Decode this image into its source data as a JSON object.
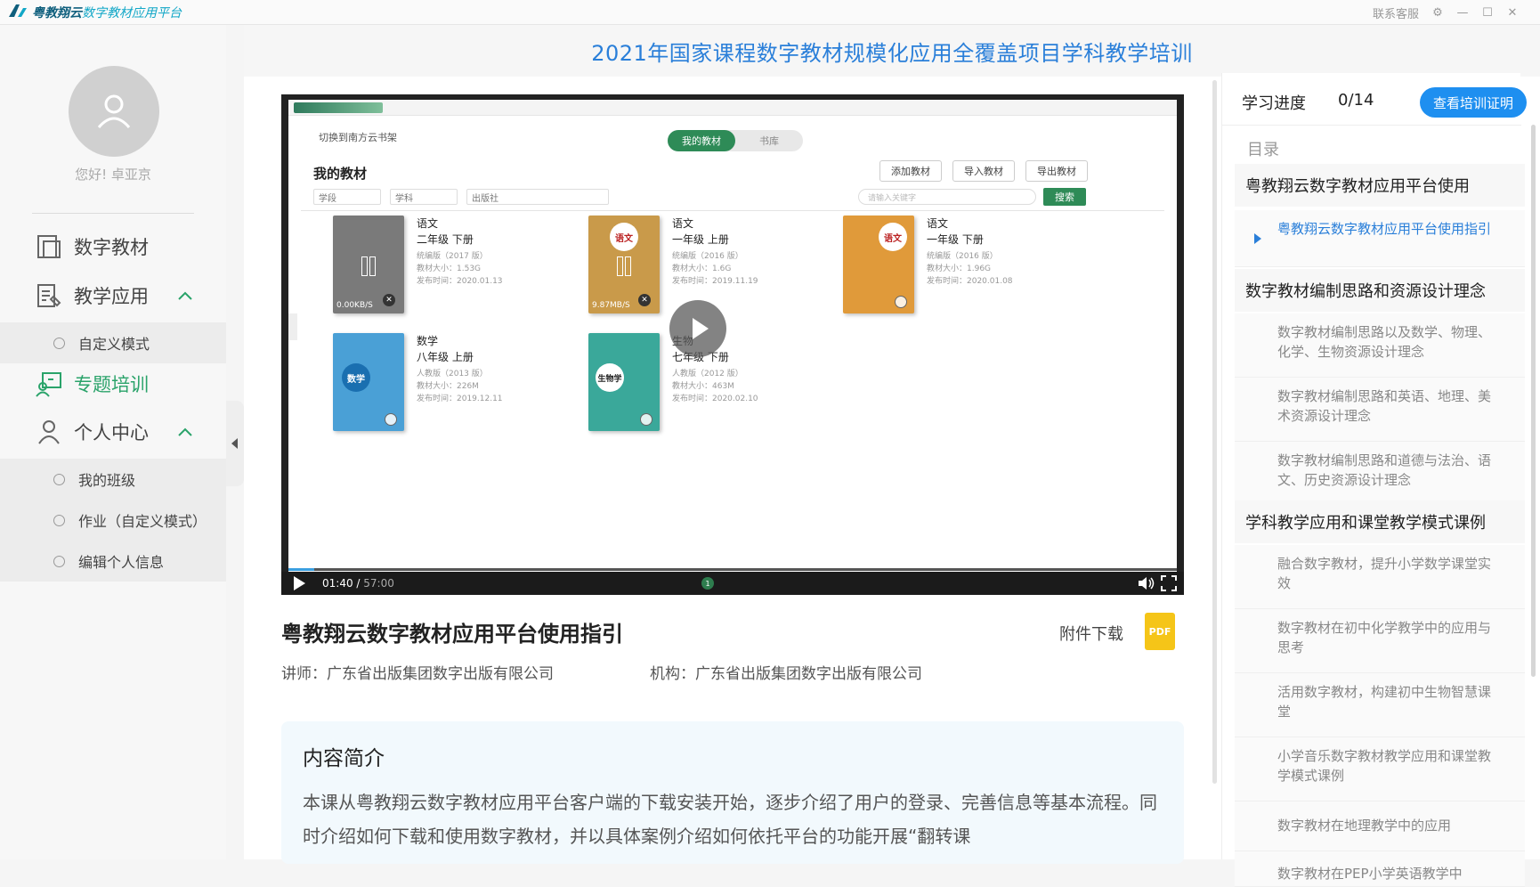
{
  "app": {
    "name_main": "粤教翔云",
    "name_accent": "数字教材应用平台",
    "window_controls": {
      "service": "联系客服"
    }
  },
  "sidebar": {
    "greeting": "您好!  卓亚京",
    "items": [
      {
        "label": "数字教材",
        "icon": "book-icon"
      },
      {
        "label": "教学应用",
        "icon": "teach-app-icon",
        "expanded": true,
        "children": [
          "自定义模式"
        ]
      },
      {
        "label": "专题培训",
        "icon": "training-icon",
        "active": true
      },
      {
        "label": "个人中心",
        "icon": "user-icon",
        "expanded": true,
        "children": [
          "我的班级",
          "作业（自定义模式）",
          "编辑个人信息"
        ]
      }
    ]
  },
  "page": {
    "title": "2021年国家课程数字教材规模化应用全覆盖项目学科教学培训"
  },
  "video": {
    "current_time": "01:40",
    "duration": "57:00",
    "progress": 0.029,
    "marker_label": "1",
    "screen": {
      "switch_label": "切换到南方云书架",
      "tabs": [
        "我的教材",
        "书库"
      ],
      "heading": "我的教材",
      "buttons": [
        "添加教材",
        "导入教材",
        "导出教材"
      ],
      "filters": [
        "学段",
        "学科",
        "出版社"
      ],
      "search_placeholder": "请输入关键字",
      "search_button": "搜索",
      "books": [
        {
          "subject": "语文",
          "grade": "二年级  下册",
          "edition": "统编版（2017 版）",
          "size": "教材大小：1.53G",
          "date": "发布时间：2020.01.13",
          "cover_color": "#7a7a7a",
          "cover_text": "",
          "speed": "0.00KB/S",
          "downloading": true
        },
        {
          "subject": "语文",
          "grade": "一年级  上册",
          "edition": "统编版（2016 版）",
          "size": "教材大小：1.6G",
          "date": "发布时间：2019.11.19",
          "cover_color": "#c99a4a",
          "cover_text": "语文",
          "speed": "9.87MB/S",
          "downloading": true
        },
        {
          "subject": "语文",
          "grade": "一年级  下册",
          "edition": "统编版（2016 版）",
          "size": "教材大小：1.96G",
          "date": "发布时间：2020.01.08",
          "cover_color": "#e09a3a",
          "cover_text": "语文",
          "speed": "",
          "downloading": false
        },
        {
          "subject": "数学",
          "grade": "八年级  上册",
          "edition": "人教版（2013 版）",
          "size": "教材大小：226M",
          "date": "发布时间：2019.12.11",
          "cover_color": "#4aa0d6",
          "cover_text": "数学",
          "speed": "",
          "downloading": false
        },
        {
          "subject": "生物",
          "grade": "七年级  下册",
          "edition": "人教版（2012 版）",
          "size": "教材大小：463M",
          "date": "发布时间：2020.02.10",
          "cover_color": "#3aa89a",
          "cover_text": "生物学",
          "speed": "",
          "downloading": false
        }
      ]
    }
  },
  "course": {
    "title": "粤教翔云数字教材应用平台使用指引",
    "attachment_label": "附件下载",
    "pdf_label": "PDF",
    "lecturer": "讲师：广东省出版集团数字出版有限公司",
    "org": "机构：广东省出版集团数字出版有限公司",
    "intro_title": "内容简介",
    "intro_body": "本课从粤教翔云数字教材应用平台客户端的下载安装开始，逐步介绍了用户的登录、完善信息等基本流程。同时介绍如何下载和使用数字教材，并以具体案例介绍如何依托平台的功能开展“翻转课"
  },
  "right_panel": {
    "progress_label": "学习进度",
    "progress_value": "0/14",
    "cert_button": "查看培训证明",
    "toc_label": "目录",
    "s1": "粤教翔云数字教材应用平台使用",
    "l1": "粤教翔云数字教材应用平台使用指引",
    "s2": "数字教材编制思路和资源设计理念",
    "l2": "数字教材编制思路以及数学、物理、化学、生物资源设计理念",
    "l3": "数字教材编制思路和英语、地理、美术资源设计理念",
    "l4": "数字教材编制思路和道德与法治、语文、历史资源设计理念",
    "s3": "学科教学应用和课堂教学模式课例",
    "l5": "融合数字教材，提升小学数学课堂实效",
    "l6": "数字教材在初中化学教学中的应用与思考",
    "l7": "活用数字教材，构建初中生物智慧课堂",
    "l8": "小学音乐数字教材教学应用和课堂教学模式课例",
    "l9": "数字教材在地理教学中的应用",
    "l10": "数字教材在PEP小学英语教学中"
  },
  "colors": {
    "accent": "#2a7fd9",
    "active_nav": "#2aa36a",
    "cert_button": "#1e8ff0",
    "pdf": "#f5c518"
  }
}
